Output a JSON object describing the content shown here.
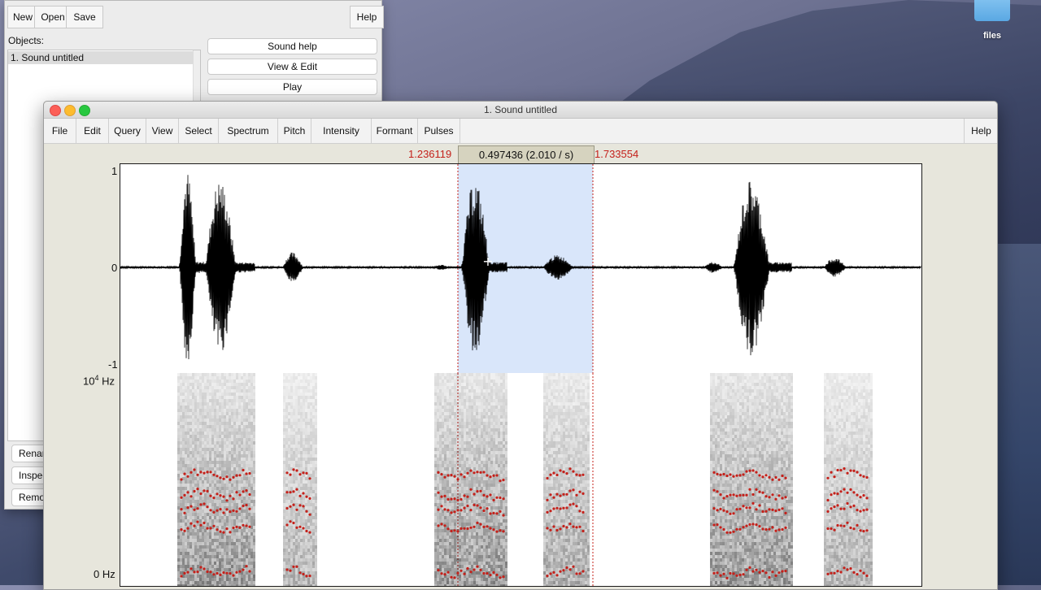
{
  "desktop": {
    "folder_label": "files"
  },
  "objects_window": {
    "toolbar": {
      "new": "New",
      "open": "Open",
      "save": "Save",
      "help": "Help"
    },
    "objects_label": "Objects:",
    "list_items": [
      "1. Sound untitled"
    ],
    "side_buttons": [
      "Sound help",
      "View & Edit",
      "Play"
    ],
    "bottom_buttons": [
      "Rename",
      "Inspect",
      "Remove"
    ]
  },
  "sound_editor": {
    "title": "1. Sound untitled",
    "menu": [
      "File",
      "Edit",
      "Query",
      "View",
      "Select",
      "Spectrum",
      "Pitch",
      "Intensity",
      "Formant",
      "Pulses"
    ],
    "help": "Help",
    "selection": {
      "start": "1.236119",
      "duration": "0.497436 (2.010 / s)",
      "end": "1.733554"
    },
    "waveform_axis": {
      "top": "1",
      "middle": "0",
      "bottom": "-1"
    },
    "spectrogram_axis": {
      "top": "10",
      "top_exp": "4",
      "top_unit": " Hz",
      "bottom": "0 Hz"
    },
    "colors": {
      "selection": "#d9e6fa",
      "formant": "#c4201a",
      "time_red": "#c4201a"
    }
  }
}
